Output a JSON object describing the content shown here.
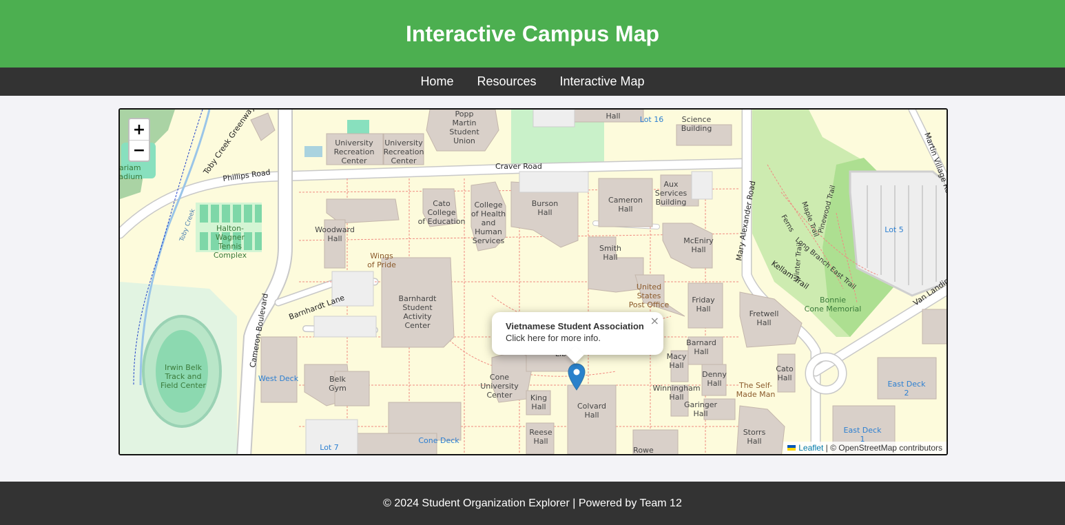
{
  "header": {
    "title": "Interactive Campus Map"
  },
  "nav": {
    "items": [
      "Home",
      "Resources",
      "Interactive Map"
    ]
  },
  "map": {
    "zoom_in": "+",
    "zoom_out": "−",
    "popup": {
      "title": "Vietnamese Student Association",
      "text": "Click here for more info.",
      "close": "×"
    },
    "attribution": {
      "leaflet": "Leaflet",
      "separator": " | © ",
      "osm": "OpenStreetMap contributors"
    },
    "labels": {
      "popp": "Popp\nMartin\nStudent\nUnion",
      "univ_rec1": "University\nRecreation\nCenter",
      "univ_rec2": "University\nRecreation\nCenter",
      "science": "Science\nBuilding",
      "lot16": "Lot 16",
      "hall_top": "Hall",
      "craver": "Craver Road",
      "phillips": "Phillips Road",
      "toby_greenway": "Toby Creek Greenway",
      "toby_creek": "Toby Creek",
      "mariam": "Mariam\nStadium",
      "cato_ed": "Cato\nCollege\nof Education",
      "coll_health": "College\nof Health\nand\nHuman\nServices",
      "burson": "Burson\nHall",
      "cameron": "Cameron\nHall",
      "aux": "Aux\nServices\nBuilding",
      "mary_alex": "Mary Alexander Road",
      "winter": "Winter Trail",
      "martin_village": "Martin Village Road",
      "pinewood": "Pinewood Trail",
      "maple": "Maple Trail",
      "ferns": "Ferns",
      "long_branch": "Long Branch East Trail",
      "kellam": "Kellam Trail",
      "lot5": "Lot 5",
      "van_landing": "Van Landing",
      "bonnie": "Bonnie\nCone Memorial",
      "halton": "Halton-\nWagner\nTennis\nComplex",
      "woodward": "Woodward\nHall",
      "wings": "Wings\nof Pride",
      "smith": "Smith\nHall",
      "mcEniry": "McEniry\nHall",
      "usps": "United\nStates\nPost Office",
      "barnhardt_lane": "Barnhardt Lane",
      "barnhardt": "Barnhardt\nStudent\nActivity\nCenter",
      "friday": "Friday\nHall",
      "fretwell": "Fretwell\nHall",
      "cameron_blvd": "Cameron Boulevard",
      "irwin": "Irwin Belk\nTrack and\nField Center",
      "west_deck": "West Deck",
      "belk_gym": "Belk\nGym",
      "cone": "Cone\nUniversity\nCenter",
      "colvard": "Colvard\nHall",
      "king": "King\nHall",
      "reese": "Reese\nHall",
      "macy": "Macy\nHall",
      "barnard": "Barnard\nHall",
      "denny": "Denny\nHall",
      "winningham": "Winningham\nHall",
      "garinger": "Garinger\nHall",
      "self_made": "The Self-\nMade Man",
      "cato_hall": "Cato\nHall",
      "storrs": "Storrs\nHall",
      "rowe": "Rowe",
      "east_deck2": "East Deck\n2",
      "east_deck1": "East Deck\n1",
      "cone_deck": "Cone Deck",
      "lot7": "Lot 7",
      "lib": "Lib"
    }
  },
  "colors": {
    "header": "#4caf50",
    "nav": "#333333",
    "building": "#d9d0c9",
    "park": "#c8facc",
    "marker": "#2a81cb"
  },
  "footer": {
    "text": "© 2024 Student Organization Explorer | Powered by Team 12"
  }
}
